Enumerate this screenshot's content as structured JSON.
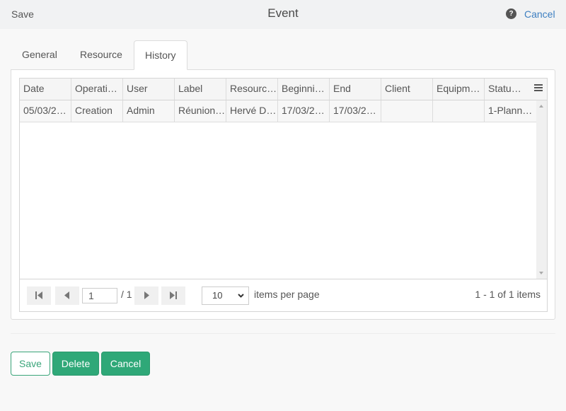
{
  "header": {
    "save_label": "Save",
    "title": "Event",
    "help_icon": "?",
    "cancel_label": "Cancel"
  },
  "tabs": [
    {
      "label": "General",
      "active": false
    },
    {
      "label": "Resource",
      "active": false
    },
    {
      "label": "History",
      "active": true
    }
  ],
  "grid": {
    "columns": [
      "Date",
      "Operati…",
      "User",
      "Label",
      "Resourc…",
      "Beginni…",
      "End",
      "Client",
      "Equipm…",
      "Statu…"
    ],
    "rows": [
      [
        "05/03/2…",
        "Creation",
        "Admin",
        "Réunion…",
        "Hervé D…",
        "17/03/2…",
        "17/03/2…",
        "",
        "",
        "1-Plann…"
      ]
    ]
  },
  "pager": {
    "current_page": "1",
    "total_pages": "/ 1",
    "page_size": "10",
    "per_page_label": "items per page",
    "info": "1 - 1 of 1 items"
  },
  "footer": {
    "save_label": "Save",
    "delete_label": "Delete",
    "cancel_label": "Cancel"
  },
  "colors": {
    "accent_green": "#2fa878",
    "link_blue": "#3d7fc1"
  }
}
